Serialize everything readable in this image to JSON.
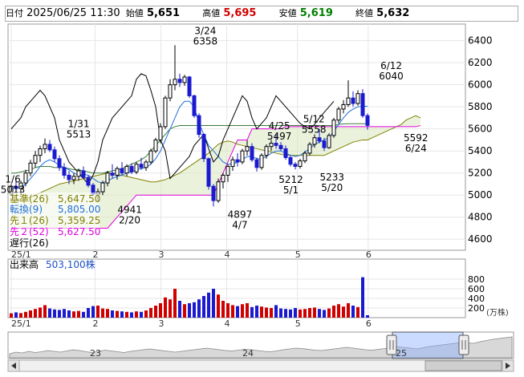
{
  "header": {
    "date_label": "日付",
    "datetime": "2025/06/25 11:30",
    "open_label": "始値",
    "open": "5,651",
    "high_label": "高値",
    "high": "5,695",
    "low_label": "安値",
    "low": "5,619",
    "close_label": "終値",
    "close": "5,632"
  },
  "legend": {
    "base": {
      "label": "基準(26)",
      "value": "5,647.50",
      "color": "#808000"
    },
    "conv": {
      "label": "転換(9)",
      "value": "5,805.00",
      "color": "#1e6fd9"
    },
    "span1": {
      "label": "先１(26)",
      "value": "5,359.25",
      "color": "#808000"
    },
    "span2": {
      "label": "先２(52)",
      "value": "5,627.50",
      "color": "#e000e0"
    },
    "lag": {
      "label": "遅行(26)",
      "value": "",
      "color": "#000000"
    }
  },
  "volume": {
    "title": "出来高",
    "value": "503,100株",
    "unit": "(万株)"
  },
  "navigator": {
    "labels": [
      "23",
      "24",
      "25"
    ]
  },
  "chart_data": {
    "type": "candlestick",
    "price_axis": {
      "ticks": [
        4600,
        4800,
        5000,
        5200,
        5400,
        5600,
        5800,
        6000,
        6200,
        6400
      ],
      "ylim": [
        4500,
        6550
      ]
    },
    "volume_axis": {
      "ticks": [
        200,
        400,
        600,
        800
      ],
      "ylim": [
        0,
        1000
      ]
    },
    "month_labels": [
      {
        "label": "25/1",
        "week": 0
      },
      {
        "label": "2",
        "week": 5.1
      },
      {
        "label": "3",
        "week": 9.1
      },
      {
        "label": "4",
        "week": 13.1
      },
      {
        "label": "5",
        "week": 17.4
      },
      {
        "label": "6",
        "week": 21.7
      }
    ],
    "annotations": [
      {
        "text": [
          "1/6",
          "5013"
        ],
        "week": 0.1,
        "price": 5013
      },
      {
        "text": [
          "1/31",
          "5513"
        ],
        "week": 4.1,
        "price": 5513
      },
      {
        "text": [
          "4941",
          "2/20"
        ],
        "week": 7.2,
        "price": 4941
      },
      {
        "text": [
          "3/24",
          "6358"
        ],
        "week": 11.8,
        "price": 6358
      },
      {
        "text": [
          "4897",
          "4/7"
        ],
        "week": 13.9,
        "price": 4897
      },
      {
        "text": [
          "4/25",
          "5497"
        ],
        "week": 16.3,
        "price": 5497
      },
      {
        "text": [
          "5/12",
          "5558"
        ],
        "week": 18.4,
        "price": 5558
      },
      {
        "text": [
          "5212",
          "5/1"
        ],
        "week": 17.0,
        "price": 5212
      },
      {
        "text": [
          "5233",
          "5/20"
        ],
        "week": 19.5,
        "price": 5233
      },
      {
        "text": [
          "6/12",
          "6040"
        ],
        "week": 23.1,
        "price": 6040
      },
      {
        "text": [
          "5592",
          "6/24"
        ],
        "week": 24.6,
        "price": 5592
      }
    ],
    "candles": [
      {
        "o": 5010,
        "h": 5100,
        "l": 4990,
        "c": 5080,
        "v": 90
      },
      {
        "o": 5080,
        "h": 5140,
        "l": 5040,
        "c": 5060,
        "v": 110
      },
      {
        "o": 5060,
        "h": 5130,
        "l": 5000,
        "c": 5110,
        "v": 95
      },
      {
        "o": 5110,
        "h": 5230,
        "l": 5080,
        "c": 5200,
        "v": 120
      },
      {
        "o": 5200,
        "h": 5320,
        "l": 5170,
        "c": 5290,
        "v": 150
      },
      {
        "o": 5290,
        "h": 5400,
        "l": 5250,
        "c": 5360,
        "v": 180
      },
      {
        "o": 5360,
        "h": 5450,
        "l": 5300,
        "c": 5420,
        "v": 210
      },
      {
        "o": 5420,
        "h": 5513,
        "l": 5380,
        "c": 5460,
        "v": 260
      },
      {
        "o": 5460,
        "h": 5500,
        "l": 5390,
        "c": 5410,
        "v": 190
      },
      {
        "o": 5410,
        "h": 5440,
        "l": 5300,
        "c": 5330,
        "v": 170
      },
      {
        "o": 5330,
        "h": 5360,
        "l": 5220,
        "c": 5250,
        "v": 160
      },
      {
        "o": 5250,
        "h": 5290,
        "l": 5150,
        "c": 5180,
        "v": 180
      },
      {
        "o": 5180,
        "h": 5220,
        "l": 5100,
        "c": 5140,
        "v": 150
      },
      {
        "o": 5140,
        "h": 5200,
        "l": 5100,
        "c": 5170,
        "v": 130
      },
      {
        "o": 5170,
        "h": 5240,
        "l": 5130,
        "c": 5220,
        "v": 140
      },
      {
        "o": 5220,
        "h": 5260,
        "l": 5150,
        "c": 5160,
        "v": 120
      },
      {
        "o": 5160,
        "h": 5180,
        "l": 5070,
        "c": 5090,
        "v": 200
      },
      {
        "o": 5090,
        "h": 5110,
        "l": 4990,
        "c": 5010,
        "v": 240
      },
      {
        "o": 5010,
        "h": 5060,
        "l": 4941,
        "c": 5030,
        "v": 250
      },
      {
        "o": 5030,
        "h": 5130,
        "l": 5000,
        "c": 5110,
        "v": 190
      },
      {
        "o": 5110,
        "h": 5220,
        "l": 5080,
        "c": 5200,
        "v": 180
      },
      {
        "o": 5200,
        "h": 5280,
        "l": 5150,
        "c": 5180,
        "v": 150
      },
      {
        "o": 5180,
        "h": 5260,
        "l": 5140,
        "c": 5240,
        "v": 140
      },
      {
        "o": 5240,
        "h": 5300,
        "l": 5180,
        "c": 5200,
        "v": 130
      },
      {
        "o": 5200,
        "h": 5280,
        "l": 5170,
        "c": 5260,
        "v": 120
      },
      {
        "o": 5260,
        "h": 5290,
        "l": 5190,
        "c": 5210,
        "v": 110
      },
      {
        "o": 5210,
        "h": 5300,
        "l": 5190,
        "c": 5280,
        "v": 130
      },
      {
        "o": 5280,
        "h": 5340,
        "l": 5230,
        "c": 5250,
        "v": 120
      },
      {
        "o": 5250,
        "h": 5320,
        "l": 5220,
        "c": 5300,
        "v": 150
      },
      {
        "o": 5300,
        "h": 5420,
        "l": 5280,
        "c": 5400,
        "v": 200
      },
      {
        "o": 5400,
        "h": 5520,
        "l": 5380,
        "c": 5500,
        "v": 250
      },
      {
        "o": 5500,
        "h": 5650,
        "l": 5470,
        "c": 5620,
        "v": 300
      },
      {
        "o": 5620,
        "h": 5900,
        "l": 5600,
        "c": 5880,
        "v": 420
      },
      {
        "o": 5880,
        "h": 6050,
        "l": 5850,
        "c": 6000,
        "v": 380
      },
      {
        "o": 6000,
        "h": 6358,
        "l": 5950,
        "c": 6050,
        "v": 600
      },
      {
        "o": 6050,
        "h": 6100,
        "l": 5980,
        "c": 6020,
        "v": 350
      },
      {
        "o": 6020,
        "h": 6090,
        "l": 5990,
        "c": 6070,
        "v": 280
      },
      {
        "o": 6070,
        "h": 6080,
        "l": 5880,
        "c": 5900,
        "v": 300
      },
      {
        "o": 5900,
        "h": 5910,
        "l": 5700,
        "c": 5720,
        "v": 320
      },
      {
        "o": 5720,
        "h": 5740,
        "l": 5520,
        "c": 5550,
        "v": 380
      },
      {
        "o": 5550,
        "h": 5560,
        "l": 5300,
        "c": 5330,
        "v": 450
      },
      {
        "o": 5330,
        "h": 5340,
        "l": 5050,
        "c": 5080,
        "v": 520
      },
      {
        "o": 5080,
        "h": 5100,
        "l": 4897,
        "c": 4950,
        "v": 600
      },
      {
        "o": 4950,
        "h": 5150,
        "l": 4930,
        "c": 5120,
        "v": 480
      },
      {
        "o": 5120,
        "h": 5200,
        "l": 5060,
        "c": 5180,
        "v": 350
      },
      {
        "o": 5180,
        "h": 5280,
        "l": 5120,
        "c": 5260,
        "v": 300
      },
      {
        "o": 5260,
        "h": 5350,
        "l": 5220,
        "c": 5320,
        "v": 260
      },
      {
        "o": 5320,
        "h": 5380,
        "l": 5260,
        "c": 5300,
        "v": 240
      },
      {
        "o": 5300,
        "h": 5420,
        "l": 5280,
        "c": 5400,
        "v": 280
      },
      {
        "o": 5400,
        "h": 5497,
        "l": 5360,
        "c": 5440,
        "v": 300
      },
      {
        "o": 5440,
        "h": 5470,
        "l": 5300,
        "c": 5320,
        "v": 220
      },
      {
        "o": 5320,
        "h": 5340,
        "l": 5212,
        "c": 5250,
        "v": 250
      },
      {
        "o": 5250,
        "h": 5380,
        "l": 5230,
        "c": 5360,
        "v": 230
      },
      {
        "o": 5360,
        "h": 5460,
        "l": 5330,
        "c": 5440,
        "v": 210
      },
      {
        "o": 5440,
        "h": 5500,
        "l": 5400,
        "c": 5470,
        "v": 200
      },
      {
        "o": 5470,
        "h": 5558,
        "l": 5420,
        "c": 5450,
        "v": 260
      },
      {
        "o": 5450,
        "h": 5480,
        "l": 5400,
        "c": 5420,
        "v": 190
      },
      {
        "o": 5420,
        "h": 5450,
        "l": 5320,
        "c": 5340,
        "v": 180
      },
      {
        "o": 5340,
        "h": 5360,
        "l": 5260,
        "c": 5280,
        "v": 170
      },
      {
        "o": 5280,
        "h": 5300,
        "l": 5233,
        "c": 5260,
        "v": 200
      },
      {
        "o": 5260,
        "h": 5330,
        "l": 5240,
        "c": 5310,
        "v": 170
      },
      {
        "o": 5310,
        "h": 5400,
        "l": 5290,
        "c": 5380,
        "v": 180
      },
      {
        "o": 5380,
        "h": 5480,
        "l": 5360,
        "c": 5460,
        "v": 200
      },
      {
        "o": 5460,
        "h": 5550,
        "l": 5430,
        "c": 5520,
        "v": 210
      },
      {
        "o": 5520,
        "h": 5600,
        "l": 5470,
        "c": 5490,
        "v": 180
      },
      {
        "o": 5490,
        "h": 5520,
        "l": 5400,
        "c": 5430,
        "v": 160
      },
      {
        "o": 5430,
        "h": 5560,
        "l": 5420,
        "c": 5540,
        "v": 190
      },
      {
        "o": 5540,
        "h": 5700,
        "l": 5520,
        "c": 5680,
        "v": 250
      },
      {
        "o": 5680,
        "h": 5800,
        "l": 5650,
        "c": 5780,
        "v": 280
      },
      {
        "o": 5780,
        "h": 5860,
        "l": 5740,
        "c": 5820,
        "v": 230
      },
      {
        "o": 5820,
        "h": 6040,
        "l": 5800,
        "c": 5880,
        "v": 300
      },
      {
        "o": 5880,
        "h": 5940,
        "l": 5800,
        "c": 5830,
        "v": 250
      },
      {
        "o": 5830,
        "h": 5950,
        "l": 5810,
        "c": 5920,
        "v": 220
      },
      {
        "o": 5920,
        "h": 5960,
        "l": 5700,
        "c": 5720,
        "v": 840
      },
      {
        "o": 5720,
        "h": 5740,
        "l": 5592,
        "c": 5632,
        "v": 50
      }
    ],
    "indicators": {
      "conv_line": [
        5060,
        5070,
        5070,
        5100,
        5150,
        5200,
        5260,
        5300,
        5320,
        5300,
        5270,
        5250,
        5230,
        5200,
        5180,
        5190,
        5180,
        5150,
        5120,
        5110,
        5130,
        5150,
        5170,
        5180,
        5200,
        5210,
        5230,
        5240,
        5250,
        5280,
        5330,
        5400,
        5500,
        5600,
        5700,
        5800,
        5850,
        5850,
        5800,
        5650,
        5550,
        5450,
        5400,
        5350,
        5300,
        5280,
        5280,
        5300,
        5320,
        5350,
        5350,
        5330,
        5330,
        5350,
        5380,
        5400,
        5400,
        5380,
        5360,
        5350,
        5360,
        5390,
        5420,
        5460,
        5480,
        5500,
        5520,
        5580,
        5640,
        5700,
        5750,
        5780,
        5800,
        5805,
        5805
      ],
      "base_line": [
        5200,
        5200,
        5210,
        5220,
        5230,
        5250,
        5260,
        5260,
        5260,
        5250,
        5250,
        5250,
        5240,
        5230,
        5230,
        5220,
        5210,
        5200,
        5200,
        5200,
        5210,
        5220,
        5230,
        5240,
        5260,
        5280,
        5300,
        5320,
        5350,
        5400,
        5450,
        5500,
        5550,
        5600,
        5620,
        5630,
        5630,
        5630,
        5630,
        5630,
        5630,
        5630,
        5630,
        5630,
        5630,
        5630,
        5630,
        5630,
        5630,
        5630,
        5630,
        5630,
        5630,
        5630,
        5630,
        5630,
        5630,
        5630,
        5630,
        5630,
        5630,
        5630,
        5630,
        5630,
        5630,
        5630,
        5630,
        5630,
        5640,
        5645,
        5647,
        5647,
        5647,
        5647,
        5647
      ],
      "span1": [
        4950,
        4950,
        4960,
        4970,
        4980,
        5000,
        5020,
        5040,
        5060,
        5080,
        5100,
        5110,
        5120,
        5130,
        5140,
        5150,
        5160,
        5170,
        5180,
        5190,
        5200,
        5200,
        5190,
        5180,
        5170,
        5160,
        5150,
        5140,
        5130,
        5120,
        5120,
        5130,
        5140,
        5160,
        5180,
        5200,
        5230,
        5260,
        5290,
        5320,
        5350,
        5380,
        5420,
        5460,
        5480,
        5490,
        5480,
        5460,
        5450,
        5440,
        5430,
        5420,
        5410,
        5400,
        5390,
        5380,
        5370,
        5360,
        5360,
        5360,
        5360,
        5360,
        5360,
        5360,
        5360,
        5360,
        5380,
        5400,
        5420,
        5440,
        5460,
        5480,
        5490,
        5500,
        5500,
        5520,
        5540,
        5560,
        5580,
        5600,
        5620,
        5640,
        5680,
        5700,
        5720,
        5700
      ],
      "span2": [
        4700,
        4700,
        4700,
        4700,
        4700,
        4700,
        4700,
        4700,
        4700,
        4700,
        4700,
        4700,
        4700,
        4700,
        4700,
        4700,
        4700,
        4700,
        4700,
        4700,
        4700,
        4750,
        4800,
        4850,
        4900,
        4950,
        5000,
        5000,
        5000,
        5000,
        5000,
        5000,
        5000,
        5000,
        5000,
        5000,
        5000,
        5000,
        5000,
        5000,
        5000,
        5000,
        5000,
        5100,
        5200,
        5300,
        5400,
        5500,
        5500,
        5500,
        5600,
        5600,
        5600,
        5600,
        5600,
        5600,
        5600,
        5620,
        5620,
        5620,
        5620,
        5620,
        5620,
        5620,
        5620,
        5620,
        5620,
        5620,
        5620,
        5620,
        5620,
        5620,
        5620,
        5620,
        5620,
        5620,
        5620,
        5620,
        5620,
        5620,
        5620,
        5620,
        5620,
        5620,
        5620,
        5630
      ],
      "lagging": [
        5600,
        5650,
        5700,
        5800,
        5850,
        5900,
        5950,
        5900,
        5800,
        5700,
        5500,
        5400,
        5300,
        5250,
        5200,
        5150,
        5100,
        5180,
        5300,
        5500,
        5600,
        5700,
        5750,
        5800,
        5850,
        5900,
        6050,
        6100,
        6080,
        5950,
        5800,
        5500,
        5400,
        5150,
        5200,
        5250,
        5300,
        5350,
        5450,
        5500,
        5550,
        5420,
        5300,
        5350,
        5500,
        5600,
        5700,
        5800,
        5900,
        5850,
        5700,
        5600,
        5650,
        5700,
        5800,
        5900,
        5850,
        5800,
        5750,
        5700,
        5650,
        5620,
        5600,
        5640,
        5700,
        5750,
        5800,
        5850
      ]
    },
    "navigator": [
      5200,
      5240,
      5220,
      5260,
      5230,
      5250,
      5280,
      5260,
      5240,
      5270,
      5300,
      5280,
      5250,
      5230,
      5260,
      5290,
      5270,
      5250,
      5230,
      5260,
      5280,
      5300,
      5320,
      5300,
      5280,
      5260,
      5240,
      5260,
      5280,
      5300,
      5320,
      5340,
      5320,
      5300,
      5280,
      5270,
      5290,
      5310,
      5300,
      5280,
      5260,
      5250,
      5270,
      5300,
      5320,
      5340,
      5330,
      5310,
      5290,
      5280,
      5300,
      5320,
      5340,
      5360,
      5340,
      5320,
      5300,
      5290,
      5310,
      5330,
      5350,
      5370,
      5360,
      5340,
      5320,
      5350,
      5380,
      5400,
      5420,
      5440,
      5460,
      5480,
      5470,
      5460,
      5500,
      5530,
      5560,
      5580,
      5600,
      5620
    ]
  }
}
